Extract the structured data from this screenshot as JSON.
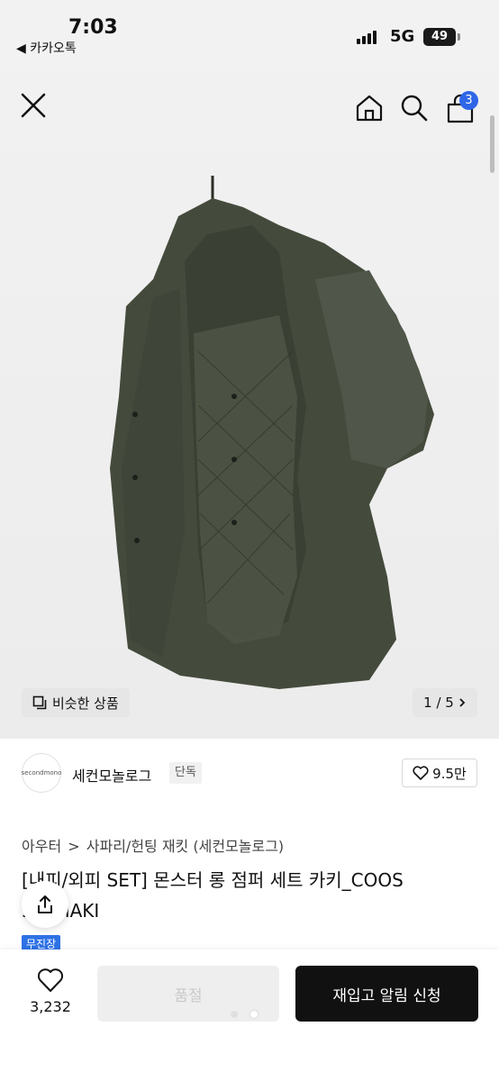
{
  "status_bar": {
    "time": "7:03",
    "back_app": "◀ 카카오톡",
    "network": "5G",
    "battery": "49"
  },
  "nav": {
    "cart_count": "3"
  },
  "gallery": {
    "similar_label": "비슷한 상품",
    "page_indicator": "1 / 5"
  },
  "brand": {
    "logo_text": "secondmono",
    "name": "세컨모놀로그",
    "tag": "단독",
    "likes": "9.5만"
  },
  "breadcrumb": {
    "level1": "아우터",
    "level2": "사파리/헌팅 재킷 (세컨모놀로그)"
  },
  "product": {
    "title": "[내피/외피 SET] 몬스터 롱 점퍼 세트 카키_COOS 33KHAKI",
    "badge": "무진장"
  },
  "bottom": {
    "wish_count": "3,232",
    "sold_out_label": "품절",
    "restock_label": "재입고 알림 신청"
  },
  "colors": {
    "accent_blue": "#2f66e8",
    "jacket_khaki": "#4a5040",
    "dark_button": "#111111"
  }
}
